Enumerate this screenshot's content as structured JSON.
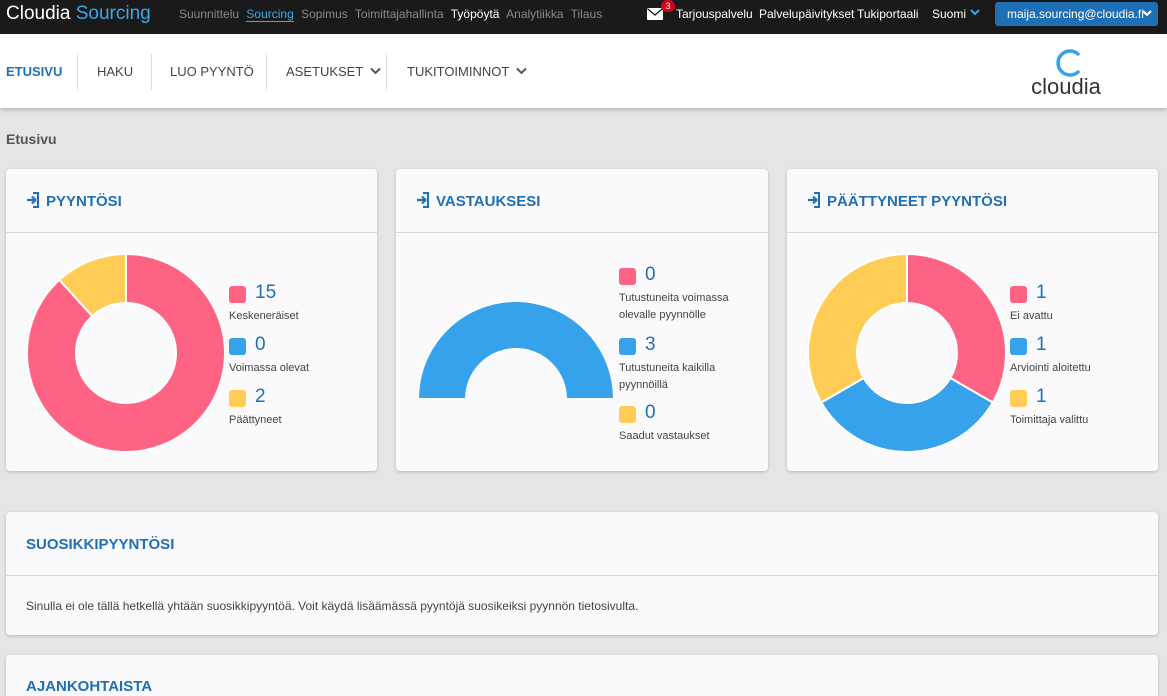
{
  "topbar": {
    "brand_part1": "Cloudia",
    "brand_part2": "Sourcing",
    "modules": [
      "Suunnittelu",
      "Sourcing",
      "Sopimus",
      "Toimittajahallinta",
      "Työpöytä",
      "Analytiikka",
      "Tilaus"
    ],
    "mail_badge": "3",
    "links": [
      "Tarjouspalvelu",
      "Palvelupäivitykset",
      "Tukiportaali"
    ],
    "language": "Suomi",
    "user_email": "maija.sourcing@cloudia.fi"
  },
  "nav": {
    "items": [
      "ETUSIVU",
      "HAKU",
      "LUO PYYNTÖ",
      "ASETUKSET",
      "TUKITOIMINNOT"
    ],
    "logo_text": "cloudia"
  },
  "breadcrumb": "Etusivu",
  "colors": {
    "red": "#ff6384",
    "blue": "#36a2eb",
    "yellow": "#ffcd56",
    "accent": "#1f6fb5"
  },
  "cards": {
    "pyyntosi": {
      "title": "PYYNTÖSI",
      "items": [
        {
          "value": "15",
          "label": "Keskeneräiset"
        },
        {
          "value": "0",
          "label": "Voimassa olevat"
        },
        {
          "value": "2",
          "label": "Päättyneet"
        }
      ]
    },
    "vastauksesi": {
      "title": "VASTAUKSESI",
      "items": [
        {
          "value": "0",
          "label": "Tutustuneita voimassa olevalle pyynnölle"
        },
        {
          "value": "3",
          "label": "Tutustuneita kaikilla pyynnöillä"
        },
        {
          "value": "0",
          "label": "Saadut vastaukset"
        }
      ]
    },
    "paattyneet": {
      "title": "PÄÄTTYNEET PYYNTÖSI",
      "items": [
        {
          "value": "1",
          "label": "Ei avattu"
        },
        {
          "value": "1",
          "label": "Arviointi aloitettu"
        },
        {
          "value": "1",
          "label": "Toimittaja valittu"
        }
      ]
    },
    "suosikit": {
      "title": "SUOSIKKIPYYNTÖSI",
      "text": "Sinulla ei ole tällä hetkellä yhtään suosikkipyyntöä. Voit käydä lisäämässä pyyntöjä suosikeiksi pyynnön tietosivulta."
    },
    "ajankohtaista": {
      "title": "AJANKOHTAISTA"
    }
  },
  "chart_data": [
    {
      "type": "pie",
      "categories": [
        "Keskeneräiset",
        "Voimassa olevat",
        "Päättyneet"
      ],
      "values": [
        15,
        0,
        2
      ]
    },
    {
      "type": "pie",
      "categories": [
        "Tutustuneita voimassa olevalle pyynnölle",
        "Tutustuneita kaikilla pyynnöillä",
        "Saadut vastaukset"
      ],
      "values": [
        0,
        3,
        0
      ]
    },
    {
      "type": "pie",
      "categories": [
        "Ei avattu",
        "Arviointi aloitettu",
        "Toimittaja valittu"
      ],
      "values": [
        1,
        1,
        1
      ]
    }
  ]
}
